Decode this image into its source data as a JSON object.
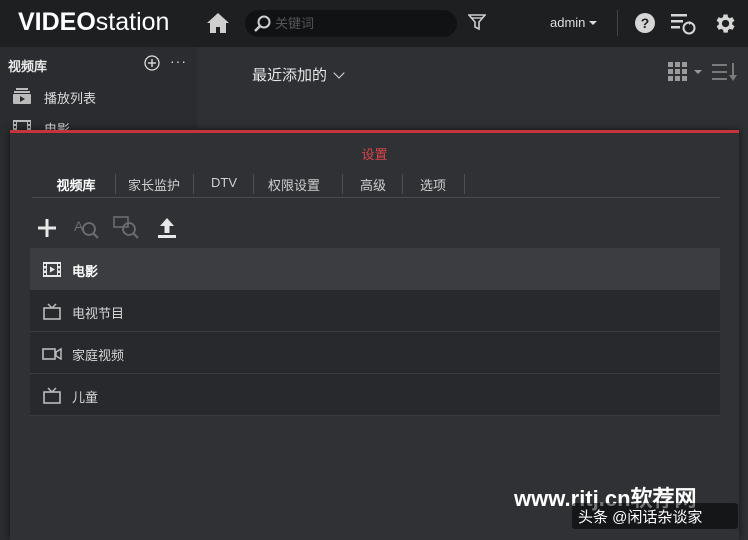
{
  "app": {
    "logo_bold": "VIDEO",
    "logo_light": "station"
  },
  "topbar": {
    "search_placeholder": "关键词",
    "user": "admin"
  },
  "sidebar": {
    "title": "视频库",
    "more": "···",
    "items": [
      {
        "label": "播放列表",
        "icon": "playlist-icon"
      },
      {
        "label": "电影",
        "icon": "film-icon"
      }
    ]
  },
  "main": {
    "title": "最近添加的"
  },
  "dialog": {
    "title": "设置",
    "tabs": [
      {
        "label": "视频库",
        "active": true
      },
      {
        "label": "家长监护",
        "active": false
      },
      {
        "label": "DTV",
        "active": false
      },
      {
        "label": "权限设置",
        "active": false
      },
      {
        "label": "高级",
        "active": false
      },
      {
        "label": "选项",
        "active": false
      }
    ],
    "toolbar": [
      "add-icon",
      "search-text-icon",
      "search-image-icon",
      "upload-icon"
    ],
    "library_rows": [
      {
        "label": "电影",
        "icon": "film-icon",
        "selected": true
      },
      {
        "label": "电视节目",
        "icon": "tv-icon",
        "selected": false
      },
      {
        "label": "家庭视频",
        "icon": "camcorder-icon",
        "selected": false
      },
      {
        "label": "儿童",
        "icon": "tv-icon",
        "selected": false
      }
    ]
  },
  "overlay": {
    "watermark": "www.ritj.cn软荐网",
    "credit": "头条 @闲话杂谈家"
  },
  "colors": {
    "accent": "#c4343a",
    "topbar": "#1e1f21",
    "background": "#2e3033"
  }
}
